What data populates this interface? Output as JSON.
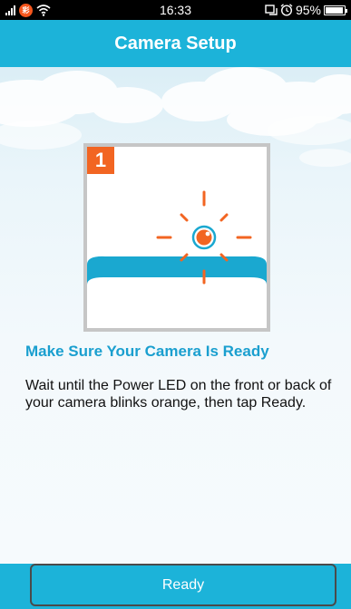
{
  "status_bar": {
    "carrier_badge": "彩",
    "time": "16:33",
    "battery": "95%",
    "icons": [
      "signal-icon",
      "wifi-icon",
      "sync-icon",
      "alarm-icon",
      "battery-icon"
    ]
  },
  "nav": {
    "title": "Camera Setup"
  },
  "illustration": {
    "step_number": "1",
    "led_color": "#f26522",
    "accent_color": "#1aa8d0"
  },
  "content": {
    "heading": "Make Sure Your Camera Is Ready",
    "description": "Wait until the Power LED on the front or back of your camera blinks orange, then tap Ready."
  },
  "footer": {
    "ready_label": "Ready"
  },
  "colors": {
    "brand": "#1cb3d9",
    "heading": "#1a9fcf",
    "step_badge": "#f26522"
  }
}
